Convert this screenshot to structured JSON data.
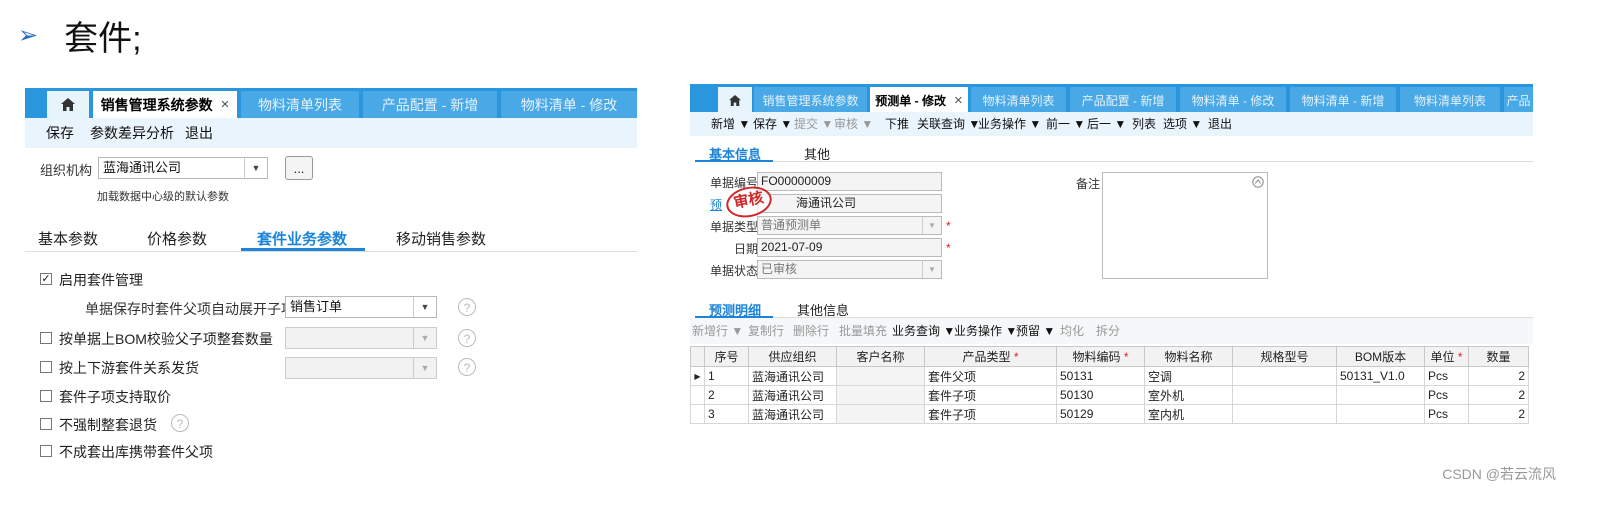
{
  "slide": {
    "bullet": "➢",
    "title": "套件;"
  },
  "panel1": {
    "tabs": [
      "销售管理系统参数",
      "物料清单列表",
      "产品配置 - 新增",
      "物料清单 - 修改"
    ],
    "tab_close": "×",
    "toolbar": [
      "保存",
      "参数差异分析",
      "退出"
    ],
    "org_label": "组织机构",
    "org_value": "蓝海通讯公司",
    "ellipsis": "...",
    "hint": "加载数据中心级的默认参数",
    "param_tabs": [
      "基本参数",
      "价格参数",
      "套件业务参数",
      "移动销售参数"
    ],
    "options": [
      {
        "label": "启用套件管理",
        "checked": true
      },
      {
        "label": "按单据上BOM校验父子项整套数量",
        "checked": false
      },
      {
        "label": "按上下游套件关系发货",
        "checked": false
      },
      {
        "label": "套件子项支持取价",
        "checked": false
      },
      {
        "label": "不强制整套退货",
        "checked": false
      },
      {
        "label": "不成套出库携带套件父项",
        "checked": false
      }
    ],
    "expand_label": "单据保存时套件父项自动展开子项",
    "expand_value": "销售订单",
    "check_mark": "✓",
    "help": "?"
  },
  "panel2": {
    "tabs": [
      "销售管理系统参数",
      "预测单 - 修改",
      "物料清单列表",
      "产品配置 - 新增",
      "物料清单 - 修改",
      "物料清单 - 新增",
      "物料清单列表",
      "产品"
    ],
    "tab_close": "×",
    "toolbar": [
      "新增 ▼",
      "保存 ▼",
      "提交 ▼",
      "审核 ▼",
      "下推",
      "关联查询 ▼",
      "业务操作 ▼",
      "前一 ▼",
      "后一 ▼",
      "列表",
      "选项 ▼",
      "退出"
    ],
    "subtabs": [
      "基本信息",
      "其他"
    ],
    "fields": {
      "bill_no_label": "单据编号",
      "bill_no": "FO00000009",
      "org_label_partial": "预",
      "org_value_partial": "海通讯公司",
      "bill_type_label": "单据类型",
      "bill_type": "普通预测单",
      "date_label": "日期",
      "date": "2021-07-09",
      "status_label": "单据状态",
      "status": "已审核",
      "remark_label": "备注",
      "required_mark": "*"
    },
    "stamp": "审核",
    "detail_tabs": [
      "预测明细",
      "其他信息"
    ],
    "grid_toolbar": [
      "新增行 ▼",
      "复制行",
      "删除行",
      "批量填充",
      "业务查询 ▼",
      "业务操作 ▼",
      "预留 ▼",
      "均化",
      "拆分"
    ],
    "columns": [
      "序号",
      "供应组织",
      "客户名称",
      "产品类型",
      "物料编码",
      "物料名称",
      "规格型号",
      "BOM版本",
      "单位",
      "数量"
    ],
    "rows": [
      [
        "1",
        "蓝海通讯公司",
        "",
        "套件父项",
        "50131",
        "空调",
        "",
        "50131_V1.0",
        "Pcs",
        "2"
      ],
      [
        "2",
        "蓝海通讯公司",
        "",
        "套件子项",
        "50130",
        "室外机",
        "",
        "",
        "Pcs",
        "2"
      ],
      [
        "3",
        "蓝海通讯公司",
        "",
        "套件子项",
        "50129",
        "室内机",
        "",
        "",
        "Pcs",
        "2"
      ]
    ]
  },
  "watermark": "CSDN @若云流风",
  "colors": {
    "tab_bar": "#2a96de",
    "toolbar_bg": "#eaf4fd",
    "accent": "#1d84d8",
    "stamp": "#d02828"
  }
}
